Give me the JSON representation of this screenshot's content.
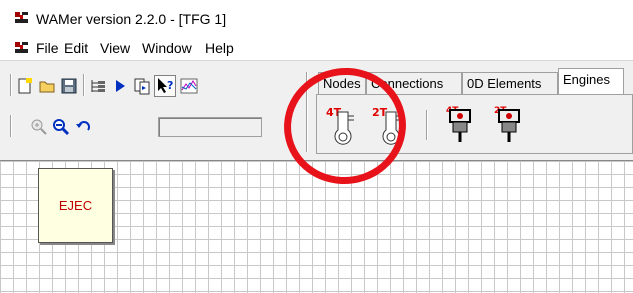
{
  "window": {
    "title": "WAMer version 2.2.0 - [TFG 1]",
    "app_icon": "wamer-logo-icon"
  },
  "menu": [
    "File",
    "Edit",
    "View",
    "Window",
    "Help"
  ],
  "toolbar": {
    "row1_icons": [
      "new-file-icon",
      "open-folder-icon",
      "save-icon",
      "tree-icon",
      "play-icon",
      "copy-icon",
      "help-pointer-icon",
      "chart-icon"
    ],
    "row2_icons": [
      "zoom-in-icon",
      "zoom-out-icon",
      "undo-icon"
    ],
    "input_value": ""
  },
  "tabs": [
    {
      "label": "Nodes",
      "active": false
    },
    {
      "label": "Connections",
      "active": false
    },
    {
      "label": "0D Elements",
      "active": false
    },
    {
      "label": "Engines",
      "active": true
    }
  ],
  "engines": {
    "items": [
      {
        "label": "4T",
        "icon": "engine-4t-icon"
      },
      {
        "label": "2T",
        "icon": "engine-2t-icon"
      },
      {
        "label": "4T",
        "icon": "piston-4t-icon"
      },
      {
        "label": "2T",
        "icon": "piston-2t-icon"
      }
    ]
  },
  "canvas": {
    "element_label": "EJEC"
  },
  "annotation_color": "#e8121a"
}
